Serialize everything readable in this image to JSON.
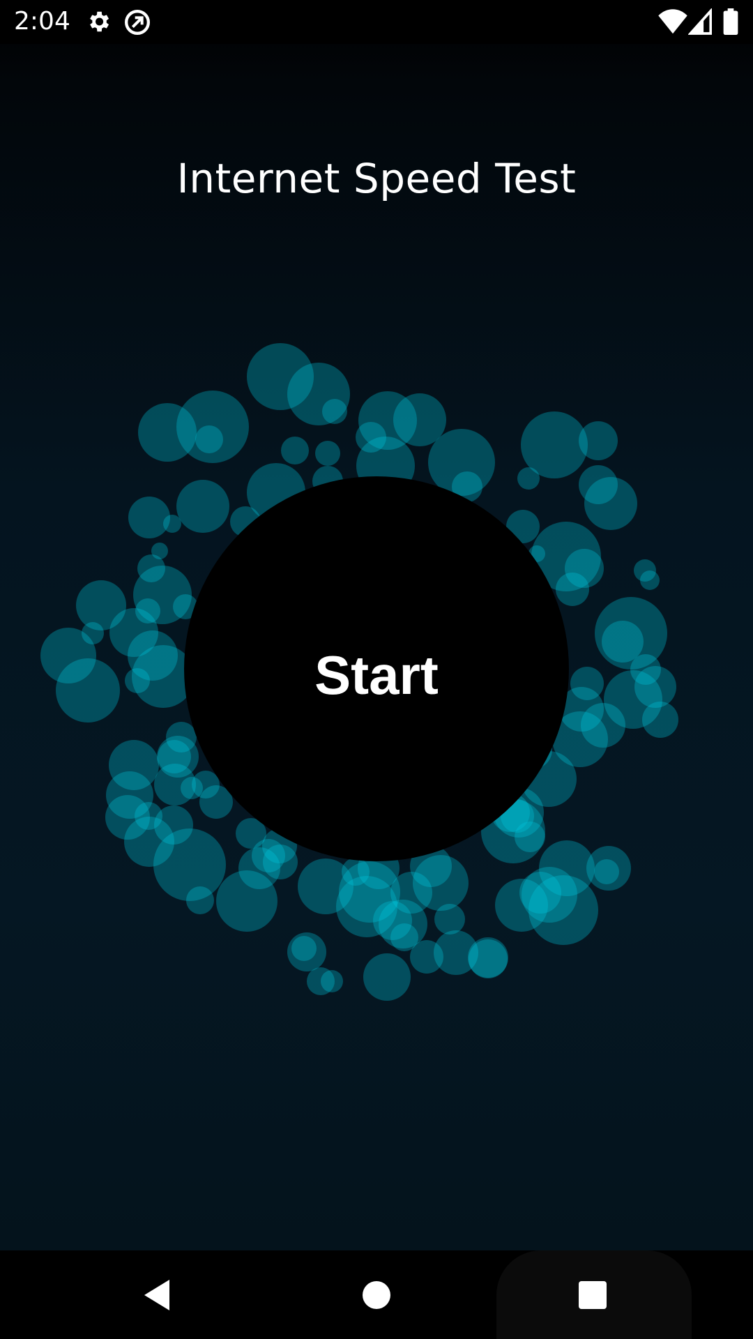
{
  "status_bar": {
    "time": "2:04",
    "icons": [
      "gear-icon",
      "sync-circle-icon",
      "wifi-icon",
      "signal-icon",
      "battery-icon"
    ]
  },
  "app": {
    "title": "Internet Speed Test",
    "start_label": "Start"
  },
  "colors": {
    "ring_start": "#5a4fc8",
    "ring_end": "#16a8d8",
    "bubble": "#00c8dc",
    "background": "#04141f"
  },
  "nav_bar": {
    "icons": [
      "back-icon",
      "home-icon",
      "recents-icon"
    ]
  }
}
